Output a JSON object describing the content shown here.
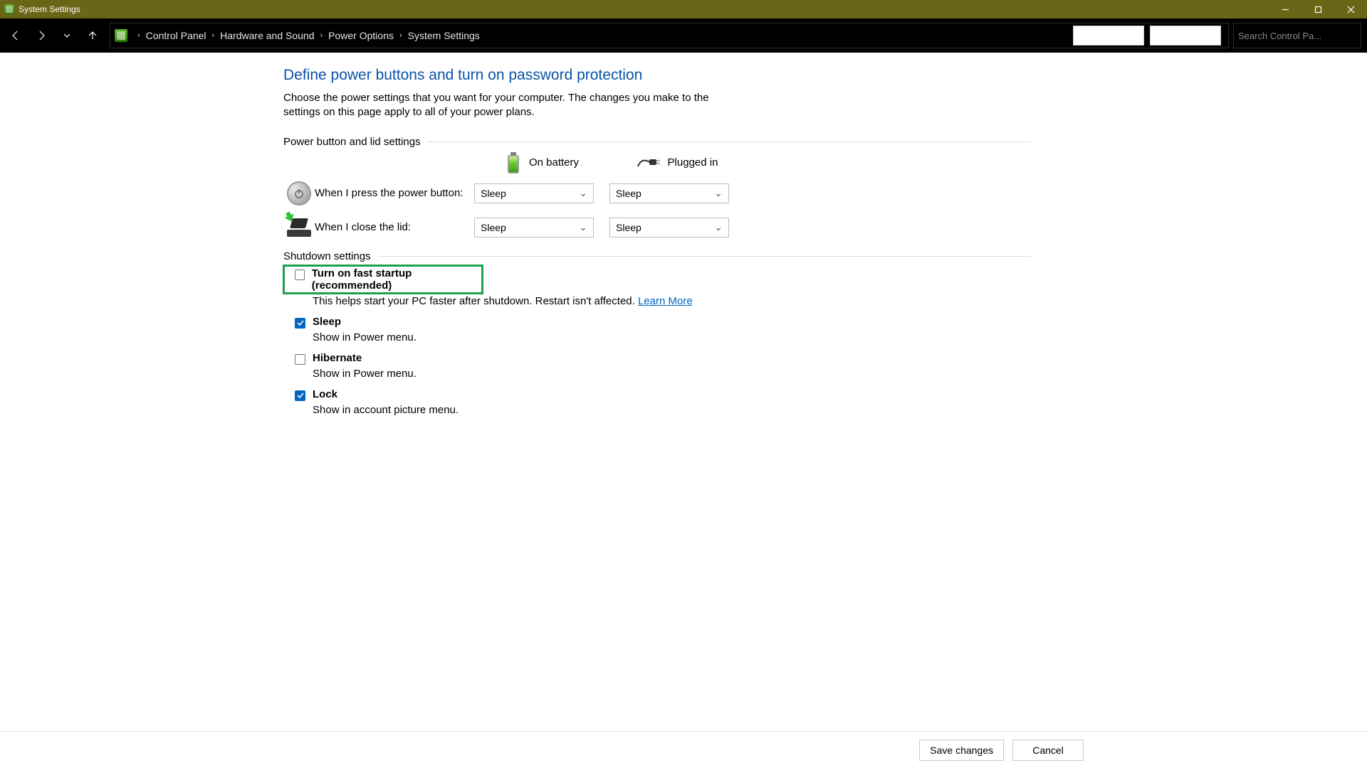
{
  "window": {
    "title": "System Settings"
  },
  "breadcrumb": {
    "root": "Control Panel",
    "level1": "Hardware and Sound",
    "level2": "Power Options",
    "level3": "System Settings"
  },
  "search": {
    "placeholder": "Search Control Pa..."
  },
  "header": {
    "title": "Define power buttons and turn on password protection",
    "description": "Choose the power settings that you want for your computer. The changes you make to the settings on this page apply to all of your power plans."
  },
  "sections": {
    "power_lid": "Power button and lid settings",
    "shutdown": "Shutdown settings"
  },
  "columns": {
    "battery": "On battery",
    "plugged": "Plugged in"
  },
  "rows": {
    "power_btn": {
      "label": "When I press the power button:",
      "battery": "Sleep",
      "plugged": "Sleep"
    },
    "lid": {
      "label": "When I close the lid:",
      "battery": "Sleep",
      "plugged": "Sleep"
    }
  },
  "shutdown": {
    "fast_startup": {
      "checked": false,
      "label": "Turn on fast startup (recommended)",
      "sub": "This helps start your PC faster after shutdown. Restart isn't affected.",
      "learn_more": "Learn More"
    },
    "sleep": {
      "checked": true,
      "label": "Sleep",
      "sub": "Show in Power menu."
    },
    "hibernate": {
      "checked": false,
      "label": "Hibernate",
      "sub": "Show in Power menu."
    },
    "lock": {
      "checked": true,
      "label": "Lock",
      "sub": "Show in account picture menu."
    }
  },
  "footer": {
    "save": "Save changes",
    "cancel": "Cancel"
  }
}
